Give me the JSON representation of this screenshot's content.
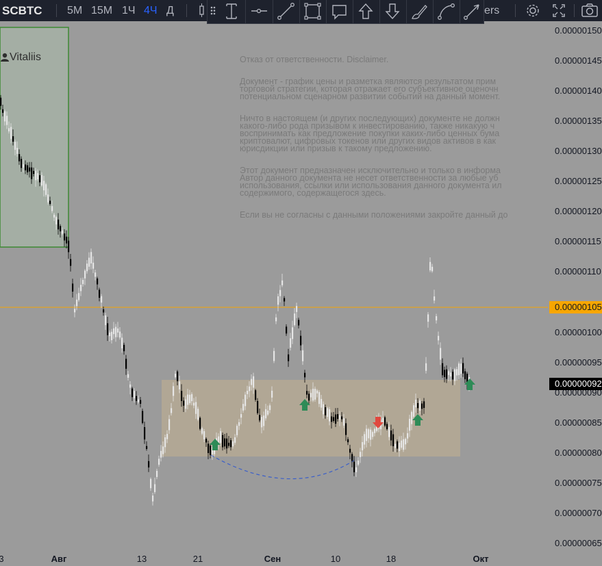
{
  "toolbar": {
    "symbol": "SCBTC",
    "timeframes": [
      {
        "label": "5М",
        "active": false
      },
      {
        "label": "15М",
        "active": false
      },
      {
        "label": "1Ч",
        "active": false
      },
      {
        "label": "4Ч",
        "active": true
      },
      {
        "label": "Д",
        "active": false
      }
    ],
    "indicators_label": "ers"
  },
  "drawing_tools": [
    "drag-handle-icon",
    "text-cursor-icon",
    "horizontal-line-icon",
    "trend-line-icon",
    "rectangle-icon",
    "callout-icon",
    "arrow-up-icon",
    "arrow-down-icon",
    "brush-icon",
    "curve-icon",
    "arrow-line-icon"
  ],
  "watermark": "Vitaliis",
  "disclaimer": {
    "title": "Отказ от ответственности. Disclaimer.",
    "p1": "Документ - график цены и разметка являются результатом прим\nторговой стратегии, которая отражает его субъективное оценочн\nпотенциальном сценарном развитии событий на данный момент.",
    "p2": "Ничто в настоящем (и других последующих) документе не должн\nкакого-либо рода призывом к инвестированию, также никакую ч\nвоспринимать как предложение покупки каких-либо ценных бума\nкриптовалют, цифровых токенов или других видов активов в как\nюрисдикции или призыв к такому предложению.",
    "p3": "Этот документ предназначен исключительно и только в информа\nАвтор данного документа не несет ответственности за любые уб\nиспользования, ссылки или использования данного документа ил\nсодержимого, содержащегося здесь.",
    "p4": "Если вы не согласны с данными положениями закройте данный до"
  },
  "price_axis": {
    "labels": [
      "0.00000150",
      "0.00000145",
      "0.00000140",
      "0.00000135",
      "0.00000130",
      "0.00000125",
      "0.00000120",
      "0.00000115",
      "0.00000110",
      "0.00000100",
      "0.00000095",
      "0.00000090",
      "0.00000085",
      "0.00000080",
      "0.00000075",
      "0.00000070",
      "0.00000065"
    ],
    "horizontal_line_price": "0.00000105",
    "current_price": "0.00000092"
  },
  "time_axis": [
    {
      "label": "3",
      "bold": false
    },
    {
      "label": "Авг",
      "bold": true
    },
    {
      "label": "13",
      "bold": false
    },
    {
      "label": "21",
      "bold": false
    },
    {
      "label": "Сен",
      "bold": true
    },
    {
      "label": "10",
      "bold": false
    },
    {
      "label": "18",
      "bold": false
    },
    {
      "label": "Окт",
      "bold": true
    }
  ],
  "colors": {
    "background": "#9b9b9b",
    "toolbar": "#1e222d",
    "active_timeframe": "#2962ff",
    "horizontal_line": "#f7a600",
    "range_box": "#b1a795",
    "green_box": "#a4aea4",
    "green_box_border": "#3c8a32",
    "arrow_up": "#2e8b57",
    "arrow_down": "#e0483e",
    "bull_candle": "#e6e6e6",
    "bear_candle": "#000000"
  }
}
